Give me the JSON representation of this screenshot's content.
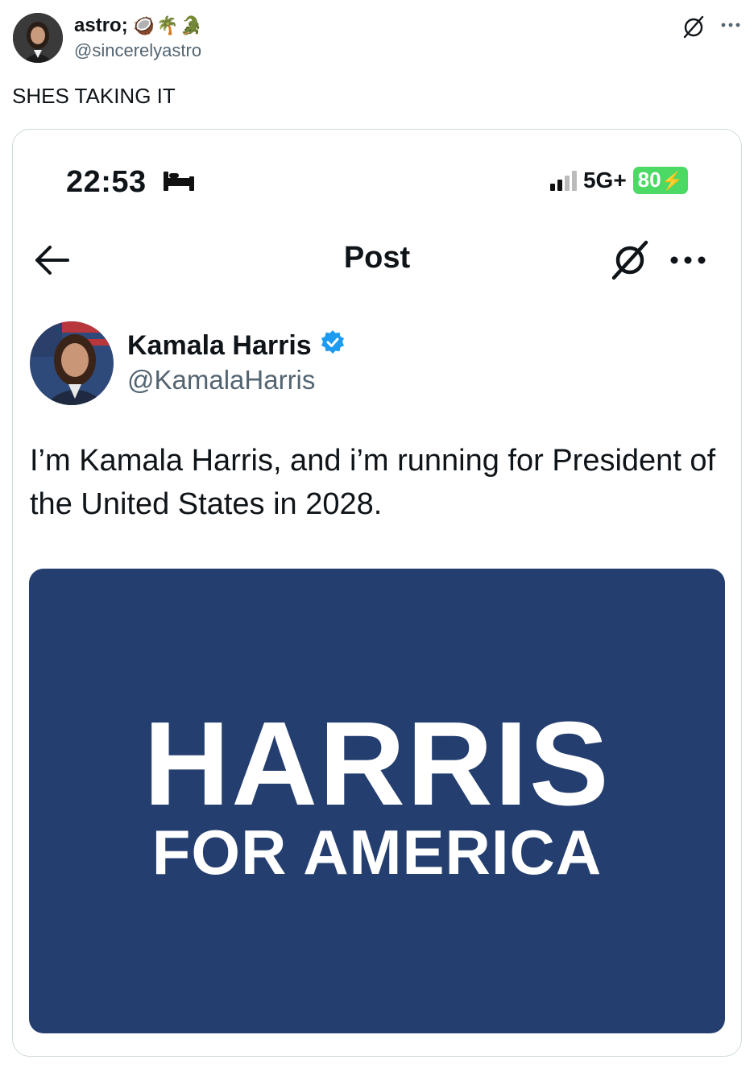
{
  "post": {
    "author": {
      "display_name": "astro;",
      "emoji_icons": [
        "🥥",
        "🌴",
        "🐊"
      ],
      "handle": "@sincerelyastro"
    },
    "text": "SHES TAKING IT"
  },
  "quoted_screenshot": {
    "status_bar": {
      "time": "22:53",
      "network": "5G+",
      "battery": "80"
    },
    "nav": {
      "title": "Post"
    },
    "tweet": {
      "display_name": "Kamala Harris",
      "handle": "@KamalaHarris",
      "text": "I’m Kamala Harris, and i’m running for President of the United States in 2028."
    },
    "banner": {
      "line1": "HARRIS",
      "line2": "FOR AMERICA",
      "background_color": "#243f6f"
    }
  },
  "colors": {
    "verified_badge": "#1d9bf0",
    "secondary_text": "#536471",
    "battery_green": "#4cd964"
  }
}
